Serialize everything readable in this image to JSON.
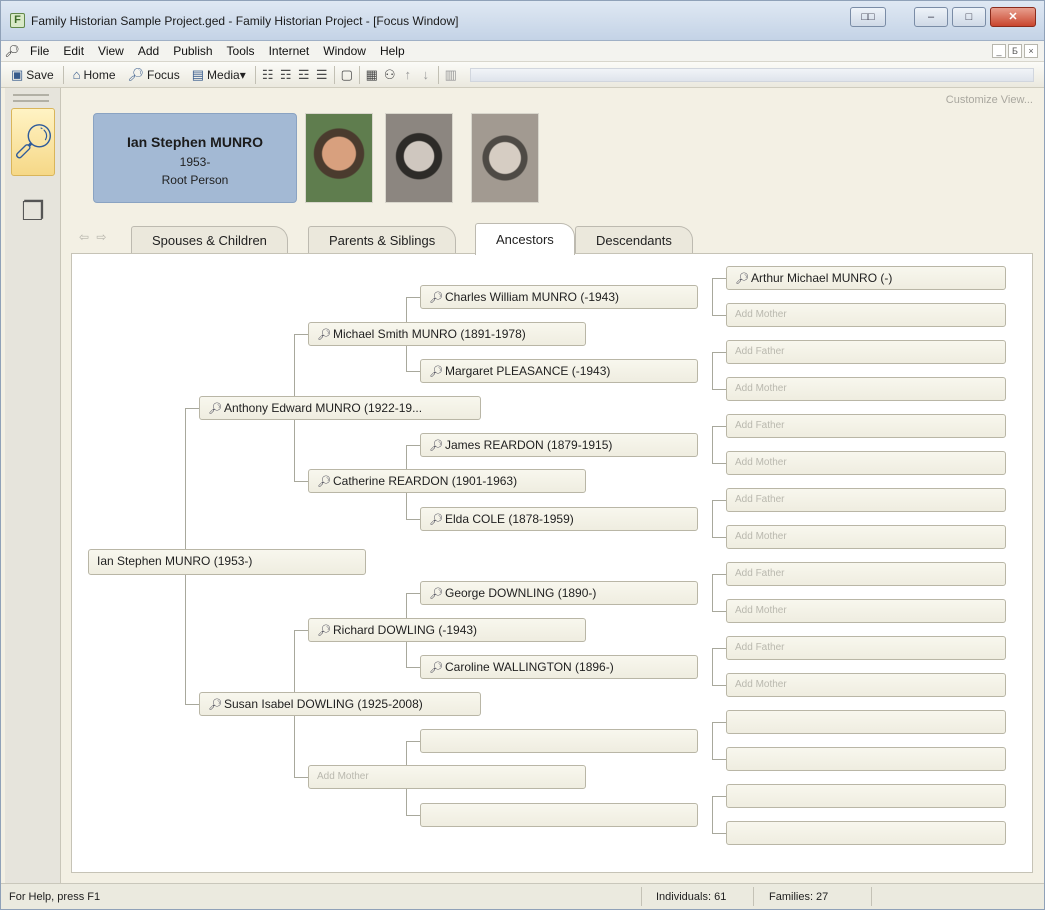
{
  "window": {
    "title": "Family Historian Sample Project.ged - Family Historian Project - [Focus Window]",
    "controls": [
      "□□",
      "–",
      "□",
      "✕"
    ]
  },
  "menubar": {
    "items": [
      "File",
      "Edit",
      "View",
      "Add",
      "Publish",
      "Tools",
      "Internet",
      "Window",
      "Help"
    ],
    "mdi_controls": [
      "_",
      "Б",
      "×"
    ]
  },
  "toolbar": {
    "save": "Save",
    "home": "Home",
    "focus": "Focus",
    "media": "Media▾"
  },
  "focus": {
    "customize_link": "Customize View...",
    "person": {
      "name": "Ian Stephen MUNRO",
      "dates": "1953-",
      "role": "Root Person"
    },
    "tabs": [
      "Spouses & Children",
      "Parents & Siblings",
      "Ancestors",
      "Descendants"
    ],
    "active_tab": "Ancestors"
  },
  "tree": {
    "root": "Ian Stephen MUNRO (1953-)",
    "gen1": [
      "Anthony Edward MUNRO (1922-19...",
      "Susan Isabel DOWLING (1925-2008)"
    ],
    "gen2": [
      "Michael Smith MUNRO (1891-1978)",
      "Catherine REARDON (1901-1963)",
      "Richard DOWLING (-1943)",
      "Add Mother"
    ],
    "gen3": [
      "Charles William MUNRO (-1943)",
      "Margaret PLEASANCE (-1943)",
      "James REARDON (1879-1915)",
      "Elda COLE (1878-1959)",
      "George DOWNLING (1890-)",
      "Caroline WALLINGTON (1896-)",
      "",
      ""
    ],
    "gen4": [
      "Arthur Michael MUNRO (-)",
      "Add Mother",
      "Add Father",
      "Add Mother",
      "Add Father",
      "Add Mother",
      "Add Father",
      "Add Mother",
      "Add Father",
      "Add Mother",
      "Add Father",
      "Add Mother",
      "",
      "",
      "",
      ""
    ]
  },
  "status": {
    "help": "For Help, press F1",
    "individuals": "Individuals: 61",
    "families": "Families: 27"
  }
}
